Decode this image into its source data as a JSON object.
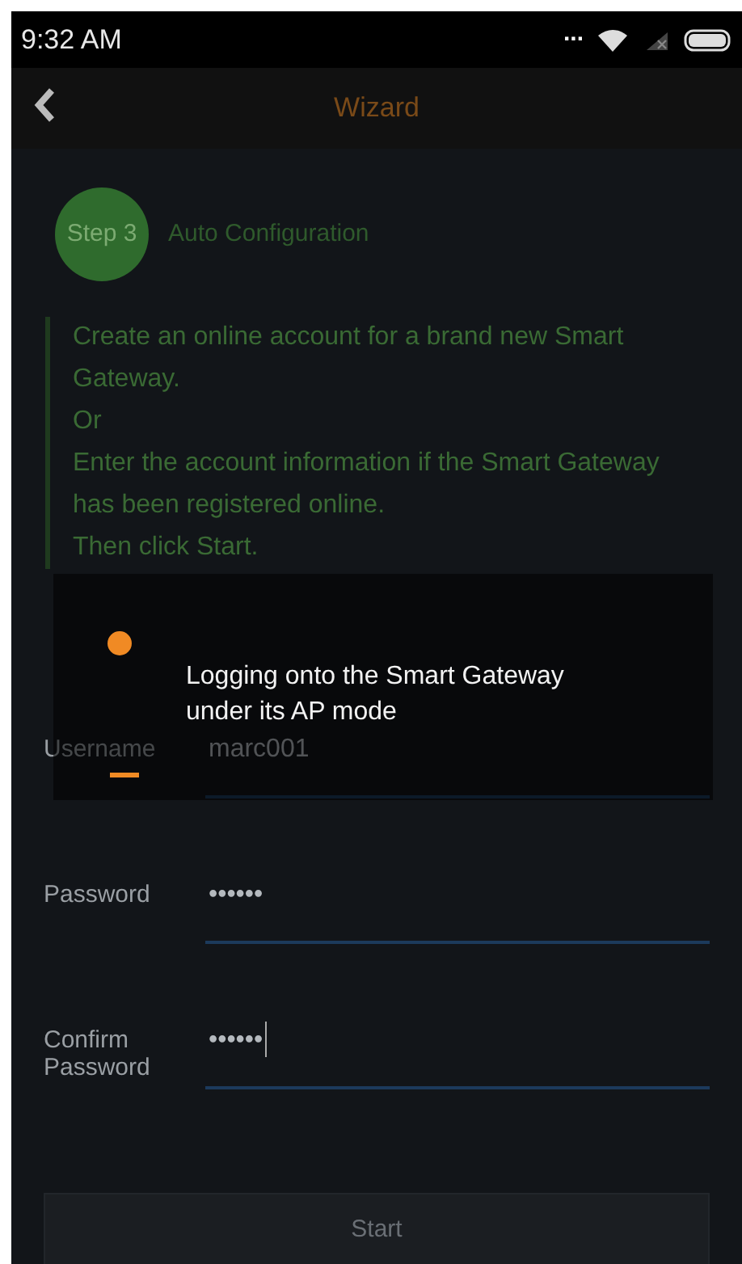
{
  "status_bar": {
    "time": "9:32 AM",
    "more": "..."
  },
  "header": {
    "title": "Wizard"
  },
  "step": {
    "badge": "Step 3",
    "title": "Auto Configuration"
  },
  "instructions": [
    "Create an online account for a brand new Smart Gateway.",
    "Or",
    "Enter the account information if the Smart Gateway has been registered online.",
    "Then click Start."
  ],
  "fields": [
    {
      "label": "Username",
      "value": "marc001",
      "focused": false
    },
    {
      "label": "Password",
      "value": "••••••",
      "focused": false
    },
    {
      "label": "Confirm Password",
      "value": "••••••",
      "focused": true
    }
  ],
  "start_button": {
    "label": "Start"
  },
  "progress_dialog": {
    "message": "Logging onto the Smart Gateway under its AP mode"
  }
}
